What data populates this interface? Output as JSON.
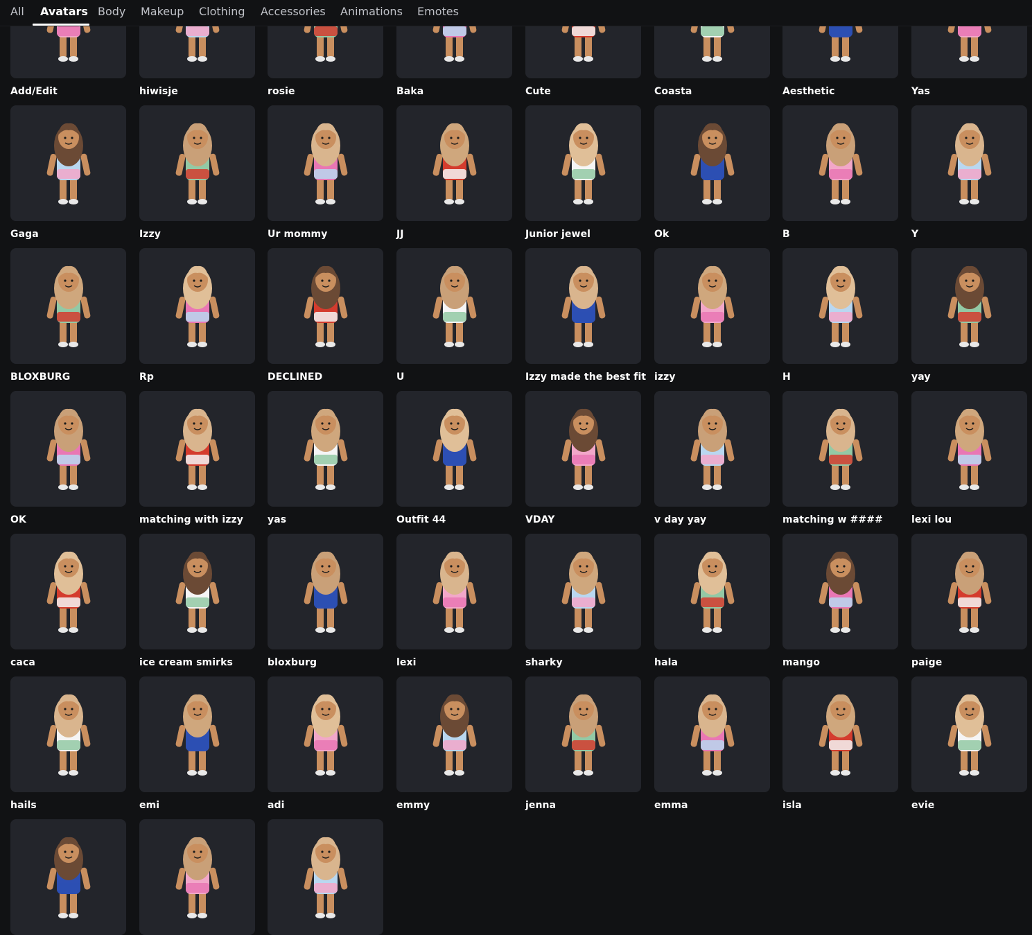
{
  "tabs": [
    {
      "label": "All",
      "active": false
    },
    {
      "label": "Avatars",
      "active": true
    },
    {
      "label": "Body",
      "active": false
    },
    {
      "label": "Makeup",
      "active": false
    },
    {
      "label": "Clothing",
      "active": false
    },
    {
      "label": "Accessories",
      "active": false
    },
    {
      "label": "Animations",
      "active": false
    },
    {
      "label": "Emotes",
      "active": false
    }
  ],
  "avatars": [
    {
      "name": "Add/Edit",
      "icon": "add-edit-thumbnail"
    },
    {
      "name": "hiwisje",
      "icon": "avatar-thumbnail"
    },
    {
      "name": "rosie",
      "icon": "avatar-thumbnail"
    },
    {
      "name": "Baka",
      "icon": "avatar-thumbnail"
    },
    {
      "name": "Cute",
      "icon": "avatar-thumbnail"
    },
    {
      "name": "Coasta",
      "icon": "avatar-thumbnail"
    },
    {
      "name": "Aesthetic",
      "icon": "avatar-thumbnail"
    },
    {
      "name": "Yas",
      "icon": "avatar-thumbnail"
    },
    {
      "name": "Gaga",
      "icon": "avatar-thumbnail"
    },
    {
      "name": "Izzy",
      "icon": "avatar-thumbnail"
    },
    {
      "name": "Ur mommy",
      "icon": "avatar-thumbnail"
    },
    {
      "name": "JJ",
      "icon": "avatar-thumbnail"
    },
    {
      "name": "Junior jewel",
      "icon": "avatar-thumbnail"
    },
    {
      "name": "Ok",
      "icon": "avatar-thumbnail"
    },
    {
      "name": "B",
      "icon": "avatar-thumbnail"
    },
    {
      "name": "Y",
      "icon": "avatar-thumbnail"
    },
    {
      "name": "BLOXBURG",
      "icon": "avatar-thumbnail"
    },
    {
      "name": "Rp",
      "icon": "avatar-thumbnail"
    },
    {
      "name": "DECLINED",
      "icon": "avatar-thumbnail"
    },
    {
      "name": "U",
      "icon": "avatar-thumbnail"
    },
    {
      "name": "Izzy made the best fit",
      "icon": "avatar-thumbnail"
    },
    {
      "name": "izzy",
      "icon": "avatar-thumbnail"
    },
    {
      "name": "H",
      "icon": "avatar-thumbnail"
    },
    {
      "name": "yay",
      "icon": "avatar-thumbnail"
    },
    {
      "name": "OK",
      "icon": "avatar-thumbnail"
    },
    {
      "name": "matching with izzy",
      "icon": "avatar-thumbnail"
    },
    {
      "name": "yas",
      "icon": "avatar-thumbnail"
    },
    {
      "name": "Outfit 44",
      "icon": "avatar-thumbnail"
    },
    {
      "name": "VDAY",
      "icon": "avatar-thumbnail"
    },
    {
      "name": "v day yay",
      "icon": "avatar-thumbnail"
    },
    {
      "name": "matching w ####",
      "icon": "avatar-thumbnail"
    },
    {
      "name": "lexi lou",
      "icon": "avatar-thumbnail"
    },
    {
      "name": "caca",
      "icon": "avatar-thumbnail"
    },
    {
      "name": "ice cream smirks",
      "icon": "avatar-thumbnail"
    },
    {
      "name": "bloxburg",
      "icon": "avatar-thumbnail"
    },
    {
      "name": "lexi",
      "icon": "avatar-thumbnail"
    },
    {
      "name": "sharky",
      "icon": "avatar-thumbnail"
    },
    {
      "name": "hala",
      "icon": "avatar-thumbnail"
    },
    {
      "name": "mango",
      "icon": "avatar-thumbnail"
    },
    {
      "name": "paige",
      "icon": "avatar-thumbnail"
    },
    {
      "name": "hails",
      "icon": "avatar-thumbnail"
    },
    {
      "name": "emi",
      "icon": "avatar-thumbnail"
    },
    {
      "name": "adi",
      "icon": "avatar-thumbnail"
    },
    {
      "name": "emmy",
      "icon": "avatar-thumbnail"
    },
    {
      "name": "jenna",
      "icon": "avatar-thumbnail"
    },
    {
      "name": "emma",
      "icon": "avatar-thumbnail"
    },
    {
      "name": "isla",
      "icon": "avatar-thumbnail"
    },
    {
      "name": "evie",
      "icon": "avatar-thumbnail"
    },
    {
      "name": "",
      "icon": "avatar-thumbnail"
    },
    {
      "name": "",
      "icon": "avatar-thumbnail"
    },
    {
      "name": "",
      "icon": "avatar-thumbnail"
    }
  ],
  "colors": {
    "background": "#111214",
    "tile": "#23252b",
    "text": "#ffffff",
    "tab_inactive": "#bfc1c7"
  }
}
